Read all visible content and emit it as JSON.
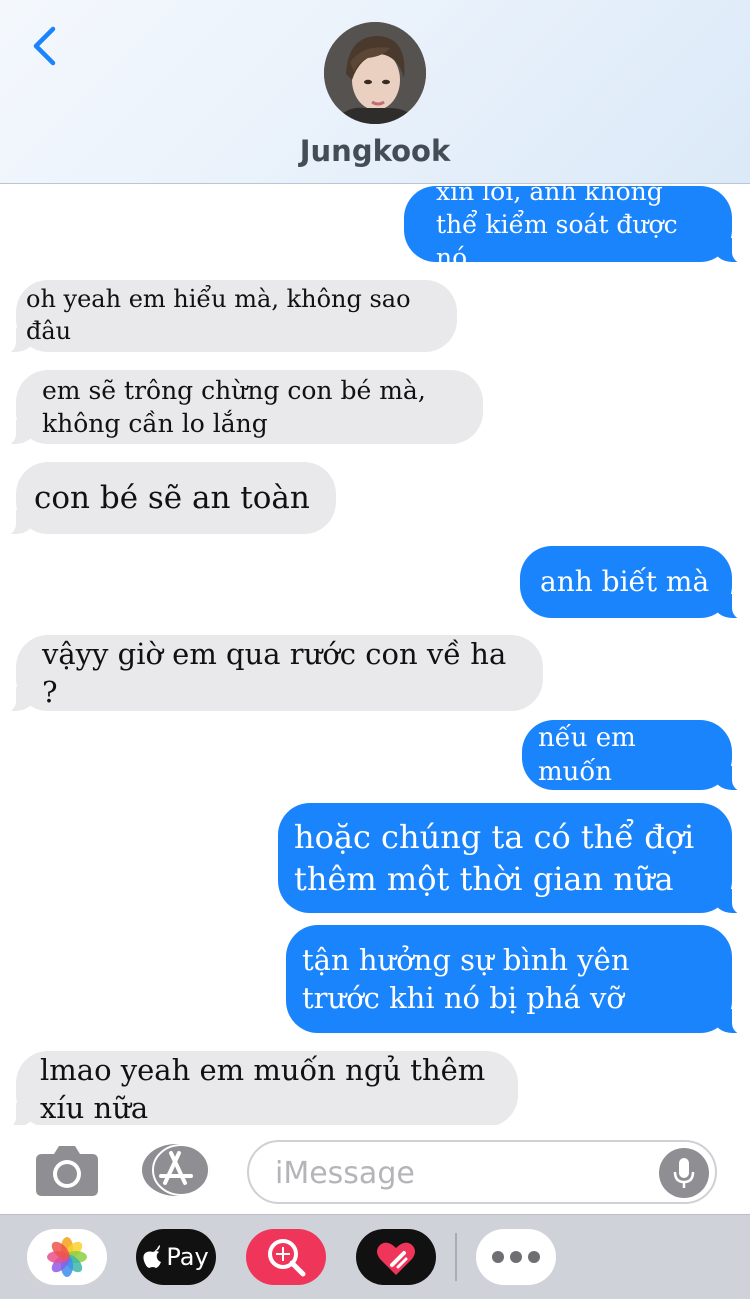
{
  "header": {
    "contact_name": "Jungkook"
  },
  "messages": [
    {
      "from": "me",
      "text": "xin lỗi, anh không thể kiểm soát được nó"
    },
    {
      "from": "them",
      "text": "oh yeah em hiểu mà, không sao đâu"
    },
    {
      "from": "them",
      "text": "em sẽ trông chừng con bé mà, không cần lo lắng"
    },
    {
      "from": "them",
      "text": "con bé sẽ an toàn"
    },
    {
      "from": "me",
      "text": "anh biết mà"
    },
    {
      "from": "them",
      "text": "vậyy giờ em qua rước con về ha ?"
    },
    {
      "from": "me",
      "text": "nếu em muốn"
    },
    {
      "from": "me",
      "text": "hoặc chúng ta có thể đợi thêm một thời gian nữa"
    },
    {
      "from": "me",
      "text": "tận hưởng sự bình yên trước khi nó bị phá vỡ"
    },
    {
      "from": "them",
      "text": "lmao yeah em muốn ngủ thêm xíu nữa"
    }
  ],
  "compose": {
    "placeholder": "iMessage"
  },
  "app_tray": {
    "apple_pay_label": "Pay"
  },
  "colors": {
    "sent_bubble": "#1a84fd",
    "received_bubble": "#e9e9eb",
    "back_chevron": "#1a84fd"
  },
  "icons": [
    "chevron-left-icon",
    "camera-icon",
    "app-store-icon",
    "microphone-icon",
    "photos-icon",
    "apple-pay-icon",
    "search-images-icon",
    "digital-touch-icon",
    "more-icon"
  ]
}
